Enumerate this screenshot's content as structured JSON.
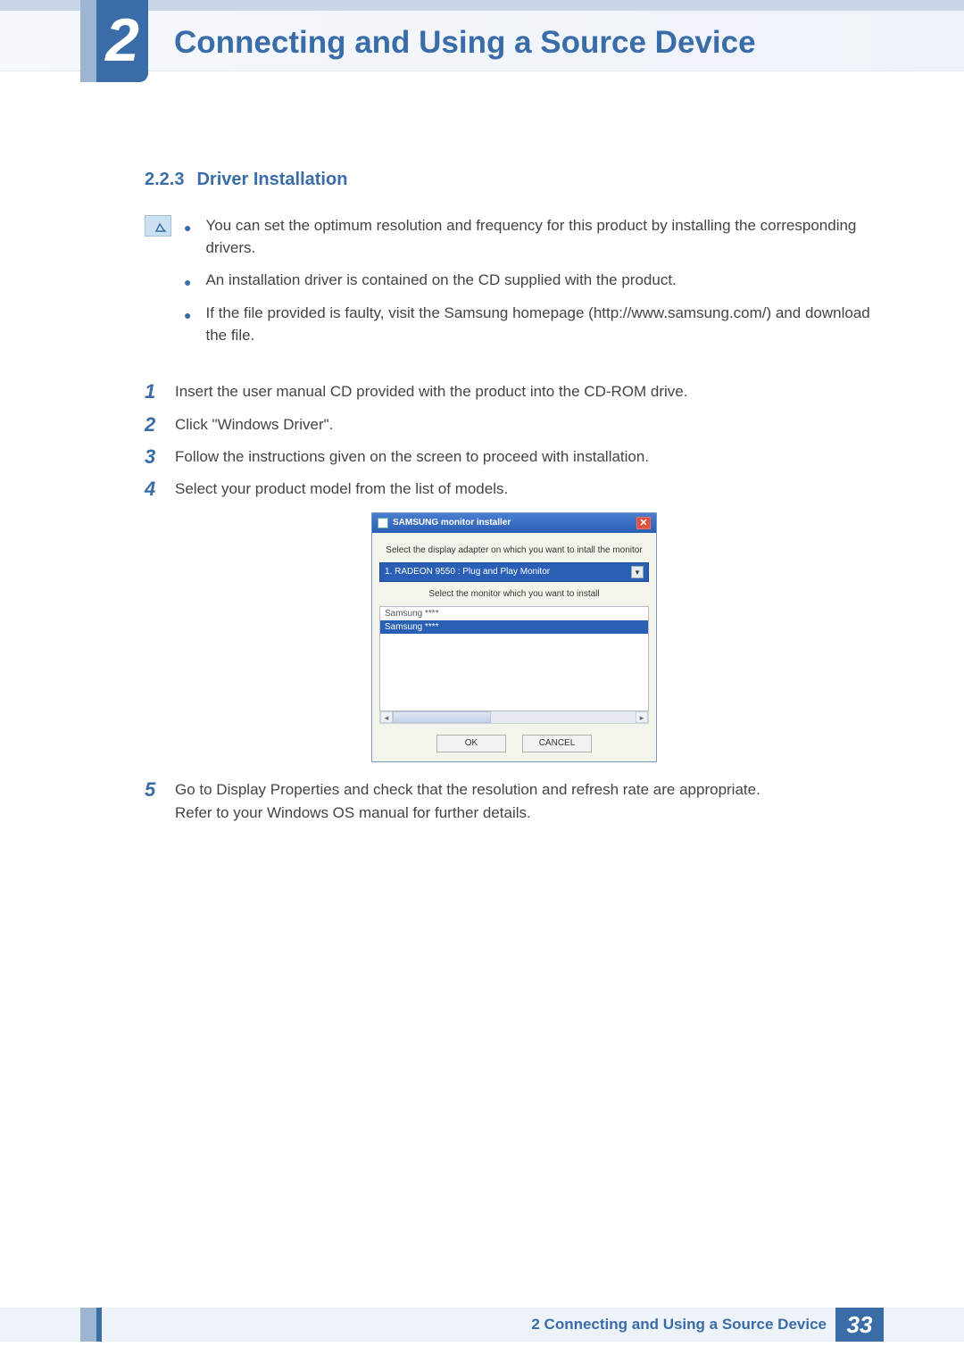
{
  "chapter": {
    "number": "2",
    "title": "Connecting and Using a Source Device"
  },
  "section": {
    "number": "2.2.3",
    "title": "Driver Installation"
  },
  "notes": [
    "You can set the optimum resolution and frequency for this product by installing the corresponding drivers.",
    "An installation driver is contained on the CD supplied with the product.",
    "If the file provided is faulty, visit the Samsung homepage (http://www.samsung.com/) and download the file."
  ],
  "steps": {
    "s1": {
      "num": "1",
      "text": "Insert the user manual CD provided with the product into the CD-ROM drive."
    },
    "s2": {
      "num": "2",
      "text": "Click \"Windows Driver\"."
    },
    "s3": {
      "num": "3",
      "text": "Follow the instructions given on the screen to proceed with installation."
    },
    "s4": {
      "num": "4",
      "text": "Select your product model from the list of models."
    },
    "s5": {
      "num": "5",
      "text": "Go to Display Properties and check that the resolution and refresh rate are appropriate."
    },
    "s5b": "Refer to your Windows OS manual for further details."
  },
  "installer": {
    "title": "SAMSUNG monitor installer",
    "label1": "Select the display adapter on which you want to intall the monitor",
    "combo": "1. RADEON 9550 : Plug and Play Monitor",
    "label2": "Select the monitor which you want to install",
    "list_item1": "Samsung ****",
    "list_item2": "Samsung ****",
    "ok": "OK",
    "cancel": "CANCEL"
  },
  "footer": {
    "text": "2 Connecting and Using a Source Device",
    "page": "33"
  }
}
